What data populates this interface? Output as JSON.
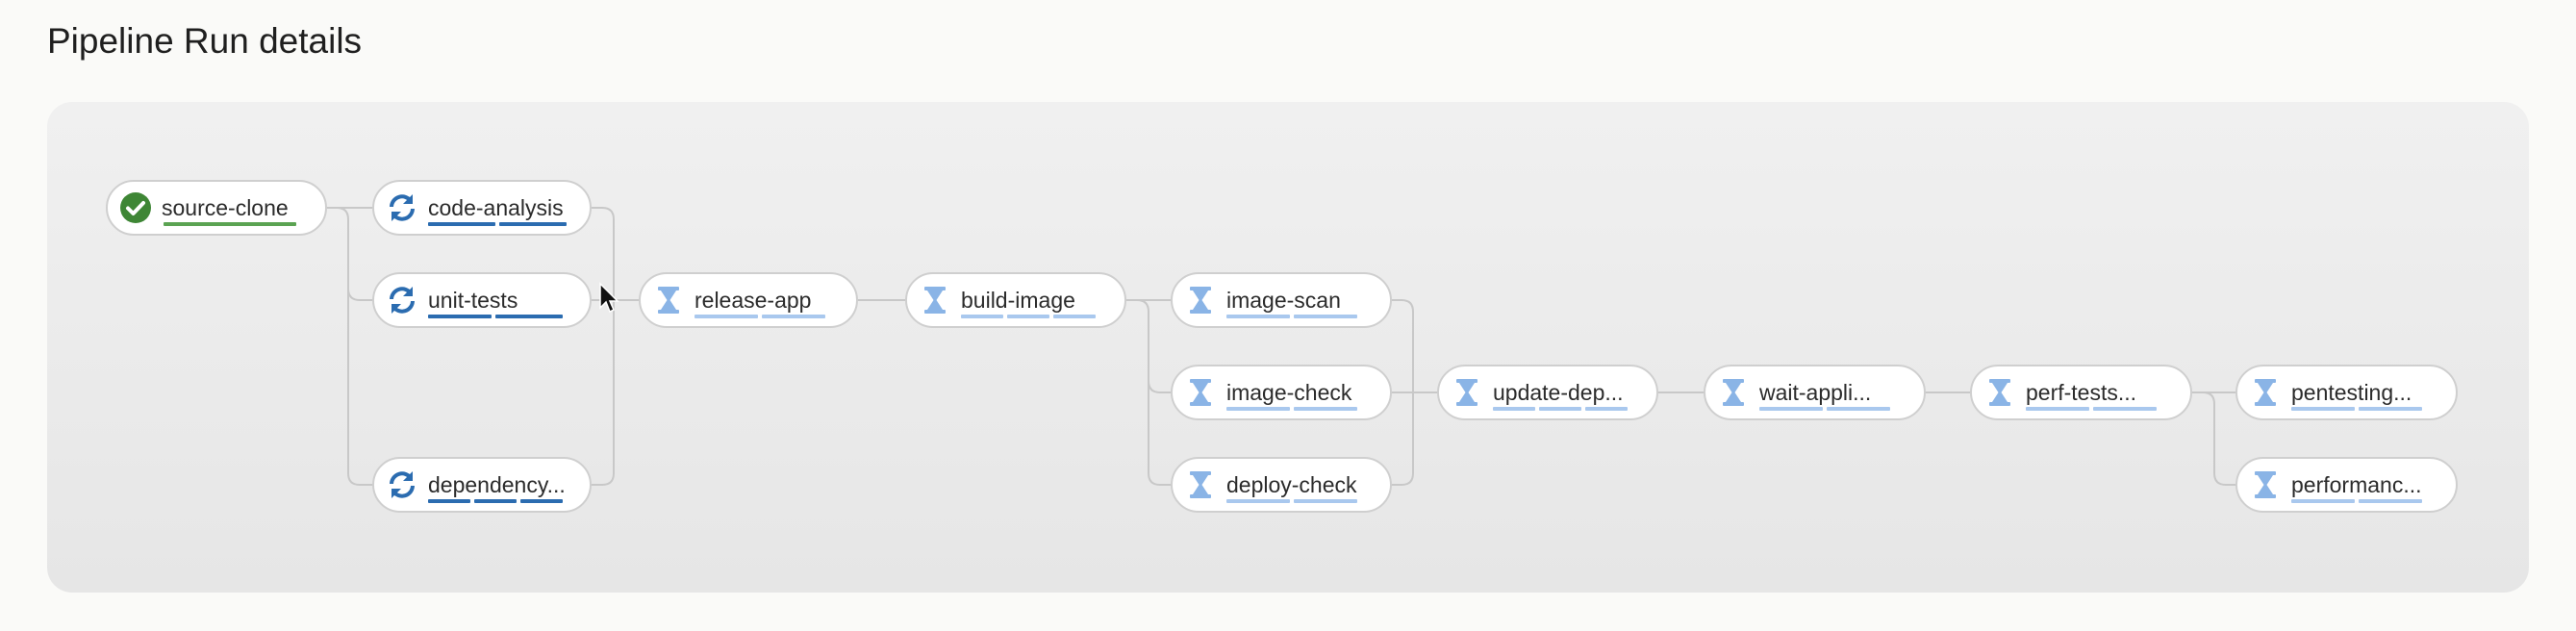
{
  "page": {
    "title": "Pipeline Run details"
  },
  "colors": {
    "success": "#3e8635",
    "running": "#2b6cb0",
    "pending": "#8ab4e6",
    "pending_bar": "#a9c8ee",
    "edge": "#c8c8c8"
  },
  "nodes": [
    {
      "id": "source-clone",
      "label": "source-clone",
      "status": "succeeded",
      "icon": "check-circle-icon"
    },
    {
      "id": "code-analysis",
      "label": "code-analysis",
      "status": "running",
      "icon": "sync-icon"
    },
    {
      "id": "unit-tests",
      "label": "unit-tests",
      "status": "running",
      "icon": "sync-icon"
    },
    {
      "id": "dependency",
      "label": "dependency...",
      "status": "running",
      "icon": "sync-icon"
    },
    {
      "id": "release-app",
      "label": "release-app",
      "status": "pending",
      "icon": "hourglass-icon"
    },
    {
      "id": "build-image",
      "label": "build-image",
      "status": "pending",
      "icon": "hourglass-icon"
    },
    {
      "id": "image-scan",
      "label": "image-scan",
      "status": "pending",
      "icon": "hourglass-icon"
    },
    {
      "id": "image-check",
      "label": "image-check",
      "status": "pending",
      "icon": "hourglass-icon"
    },
    {
      "id": "deploy-check",
      "label": "deploy-check",
      "status": "pending",
      "icon": "hourglass-icon"
    },
    {
      "id": "update-dep",
      "label": "update-dep...",
      "status": "pending",
      "icon": "hourglass-icon"
    },
    {
      "id": "wait-appli",
      "label": "wait-appli...",
      "status": "pending",
      "icon": "hourglass-icon"
    },
    {
      "id": "perf-tests",
      "label": "perf-tests...",
      "status": "pending",
      "icon": "hourglass-icon"
    },
    {
      "id": "pentesting",
      "label": "pentesting...",
      "status": "pending",
      "icon": "hourglass-icon"
    },
    {
      "id": "performanc",
      "label": "performanc...",
      "status": "pending",
      "icon": "hourglass-icon"
    }
  ]
}
